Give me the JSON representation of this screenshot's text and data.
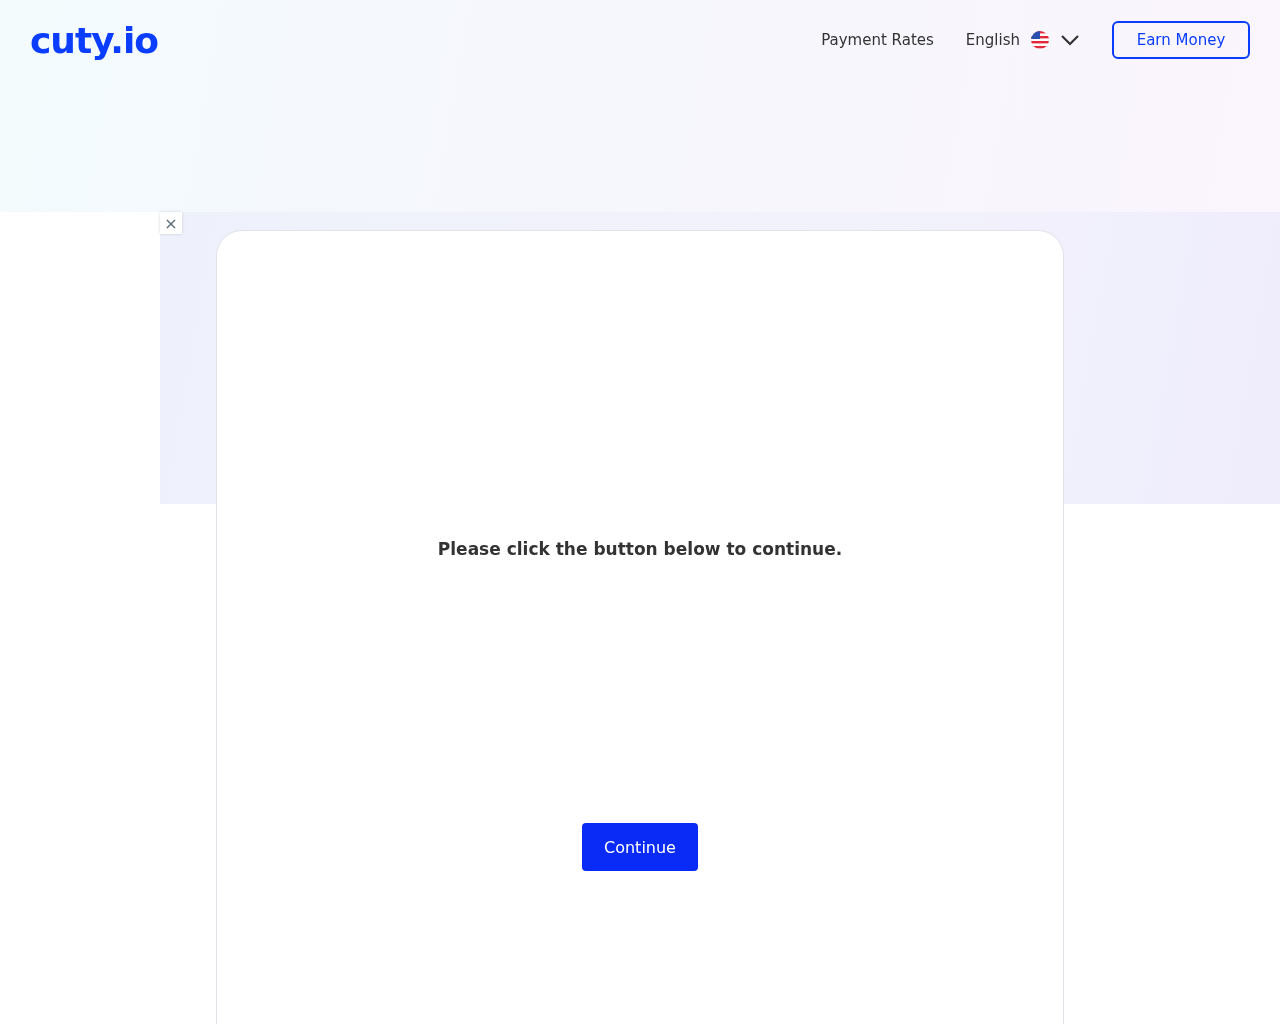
{
  "header": {
    "logo": "cuty.io",
    "nav": [
      {
        "label": "Payment Rates"
      }
    ],
    "language": {
      "label": "English"
    },
    "cta": "Earn Money"
  },
  "ad_close": "×",
  "card": {
    "message": "Please click the button below to continue.",
    "button": "Continue"
  }
}
